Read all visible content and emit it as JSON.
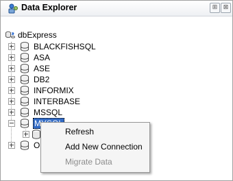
{
  "window": {
    "title": "Data Explorer",
    "pin_glyph": "⊞",
    "close_glyph": "⊠"
  },
  "tree": {
    "root": {
      "label": "dbExpress",
      "icon": "connections-icon"
    },
    "items": [
      {
        "label": "BLACKFISHSQL",
        "expanded": false
      },
      {
        "label": "ASA",
        "expanded": false
      },
      {
        "label": "ASE",
        "expanded": false
      },
      {
        "label": "DB2",
        "expanded": false
      },
      {
        "label": "INFORMIX",
        "expanded": false
      },
      {
        "label": "INTERBASE",
        "expanded": false
      },
      {
        "label": "MSSQL",
        "expanded": false
      },
      {
        "label": "MYSQL",
        "expanded": true,
        "selected": true
      },
      {
        "label": "OI",
        "expanded": false
      }
    ]
  },
  "context_menu": {
    "items": [
      {
        "label": "Refresh",
        "enabled": true
      },
      {
        "label": "Add New Connection",
        "enabled": true
      },
      {
        "label": "Migrate Data",
        "enabled": false
      }
    ]
  },
  "colors": {
    "selection": "#316ac5",
    "menu_bg": "#f5f5f5",
    "disabled_text": "#8c8c8c"
  }
}
